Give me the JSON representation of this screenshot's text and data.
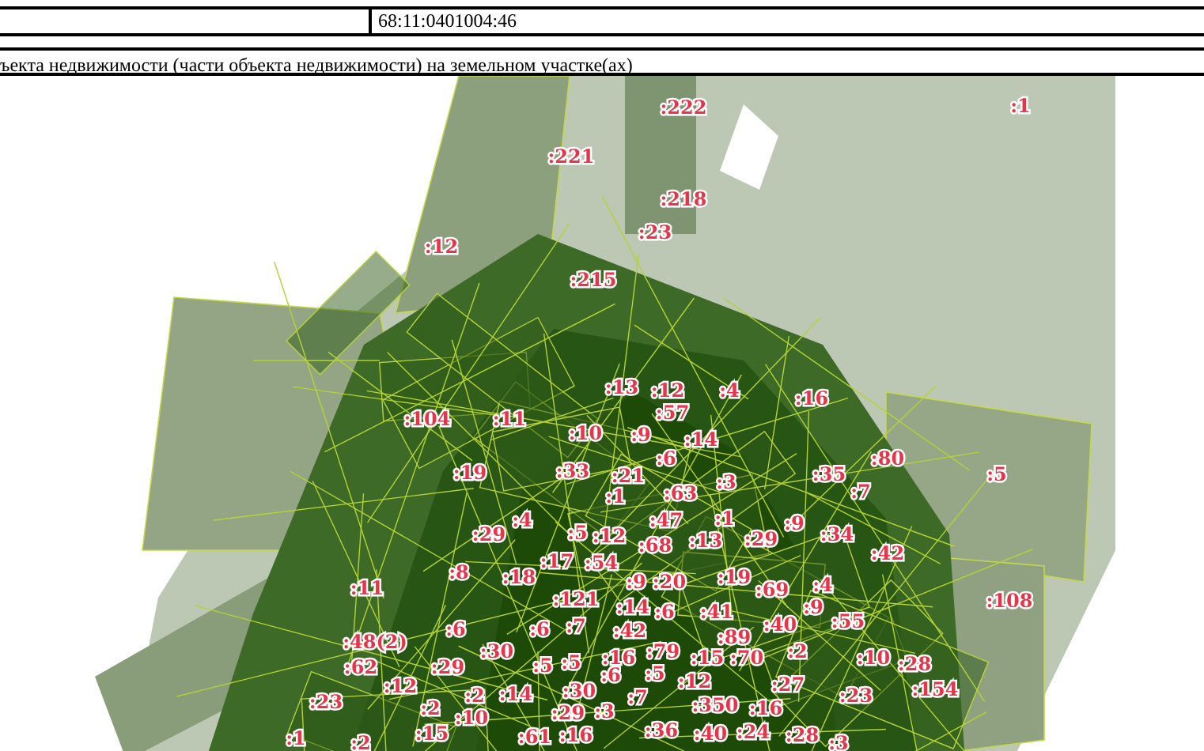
{
  "header": {
    "cadastral_number": "68:11:0401004:46"
  },
  "section_title": "ъекта недвижимости (части объекта недвижимости) на земельном участке(ах)",
  "map": {
    "labels": [
      ":222",
      ":1",
      ":221",
      ":218",
      ":23",
      ":12",
      ":215",
      ":13",
      ":12",
      ":4",
      ":16",
      ":57",
      ":104",
      ":11",
      ":10",
      ":9",
      ":14",
      ":6",
      ":80",
      ":19",
      ":33",
      ":21",
      ":3",
      ":35",
      ":5",
      ":1",
      ":63",
      ":7",
      ":47",
      ":1",
      ":9",
      ":29",
      ":4",
      ":5",
      ":12",
      ":29",
      ":34",
      ":68",
      ":13",
      ":42",
      ":17",
      ":54",
      ":11",
      ":8",
      ":18",
      ":9",
      ":20",
      ":19",
      ":69",
      ":4",
      ":121",
      ":14",
      ":6",
      ":41",
      ":9",
      ":108",
      ":48(2)",
      ":6",
      ":6",
      ":7",
      ":42",
      ":89",
      ":40",
      ":55",
      ":62",
      ":29",
      ":30",
      ":5",
      ":5",
      ":16",
      ":79",
      ":15",
      ":70",
      ":2",
      ":10",
      ":28",
      ":23",
      ":12",
      ":2",
      ":14",
      ":30",
      ":6",
      ":7",
      ":5",
      ":12",
      ":27",
      ":23",
      ":154",
      ":2",
      ":10",
      ":29",
      ":3",
      ":350",
      ":16",
      ":1",
      ":2",
      ":15",
      ":61",
      ":16",
      ":36",
      ":40",
      ":24",
      ":28",
      ":3"
    ]
  }
}
